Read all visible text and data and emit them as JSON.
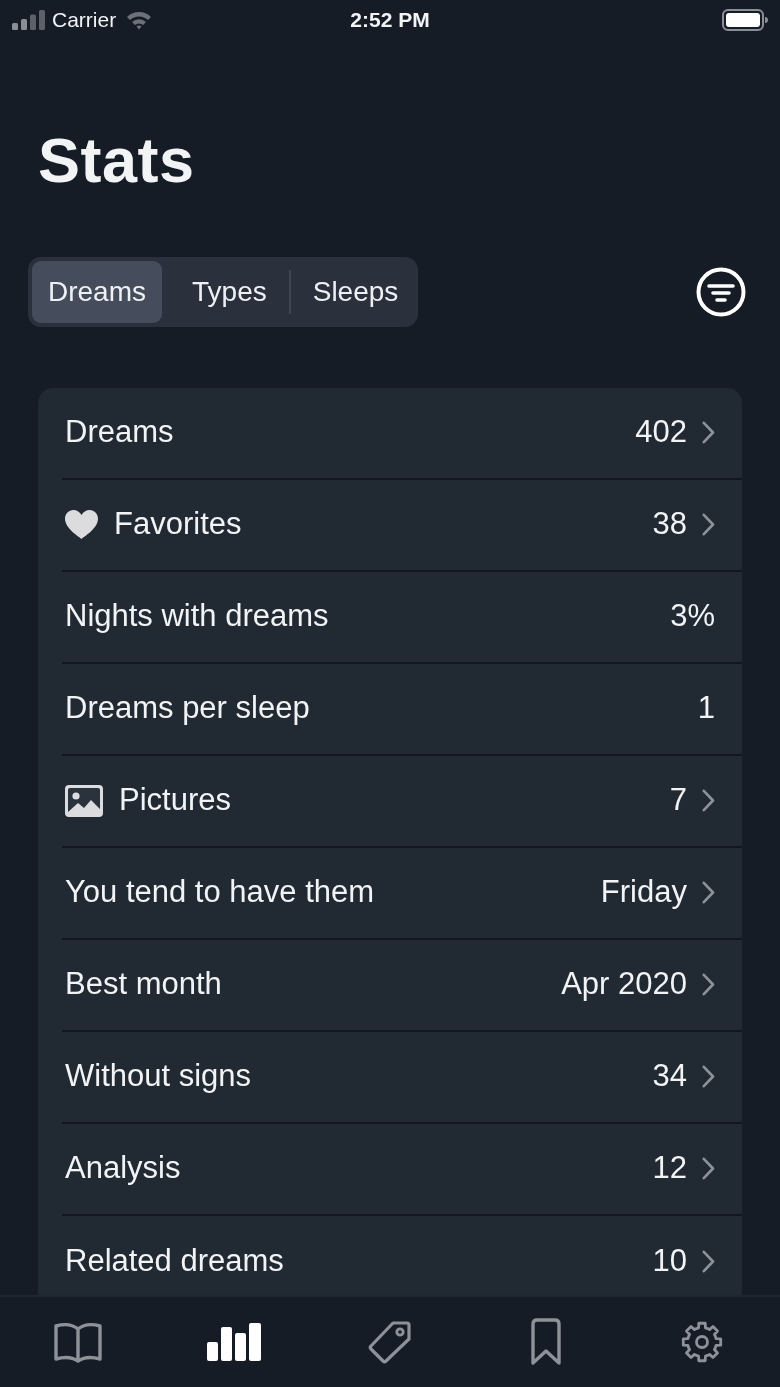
{
  "status_bar": {
    "carrier": "Carrier",
    "time": "2:52 PM"
  },
  "title": "Stats",
  "segments": [
    {
      "label": "Dreams",
      "selected": true
    },
    {
      "label": "Types",
      "selected": false
    },
    {
      "label": "Sleeps",
      "selected": false
    }
  ],
  "stats": [
    {
      "kind": "plain",
      "label": "Dreams",
      "value": "402",
      "navigable": true
    },
    {
      "kind": "favorites",
      "label": "Favorites",
      "value": "38",
      "navigable": true
    },
    {
      "kind": "plain",
      "label": "Nights with dreams",
      "value": "3%",
      "navigable": false
    },
    {
      "kind": "plain",
      "label": "Dreams per sleep",
      "value": "1",
      "navigable": false
    },
    {
      "kind": "pictures",
      "label": "Pictures",
      "value": "7",
      "navigable": true
    },
    {
      "kind": "plain",
      "label": "You tend to have them",
      "value": "Friday",
      "navigable": true
    },
    {
      "kind": "plain",
      "label": "Best month",
      "value": "Apr 2020",
      "navigable": true
    },
    {
      "kind": "plain",
      "label": "Without signs",
      "value": "34",
      "navigable": true
    },
    {
      "kind": "plain",
      "label": "Analysis",
      "value": "12",
      "navigable": true
    },
    {
      "kind": "plain",
      "label": "Related dreams",
      "value": "10",
      "navigable": true
    }
  ],
  "tab_bar": [
    {
      "kind": "journal",
      "selected": false
    },
    {
      "kind": "stats",
      "selected": true
    },
    {
      "kind": "tags",
      "selected": false
    },
    {
      "kind": "bookmarks",
      "selected": false
    },
    {
      "kind": "settings",
      "selected": false
    }
  ]
}
